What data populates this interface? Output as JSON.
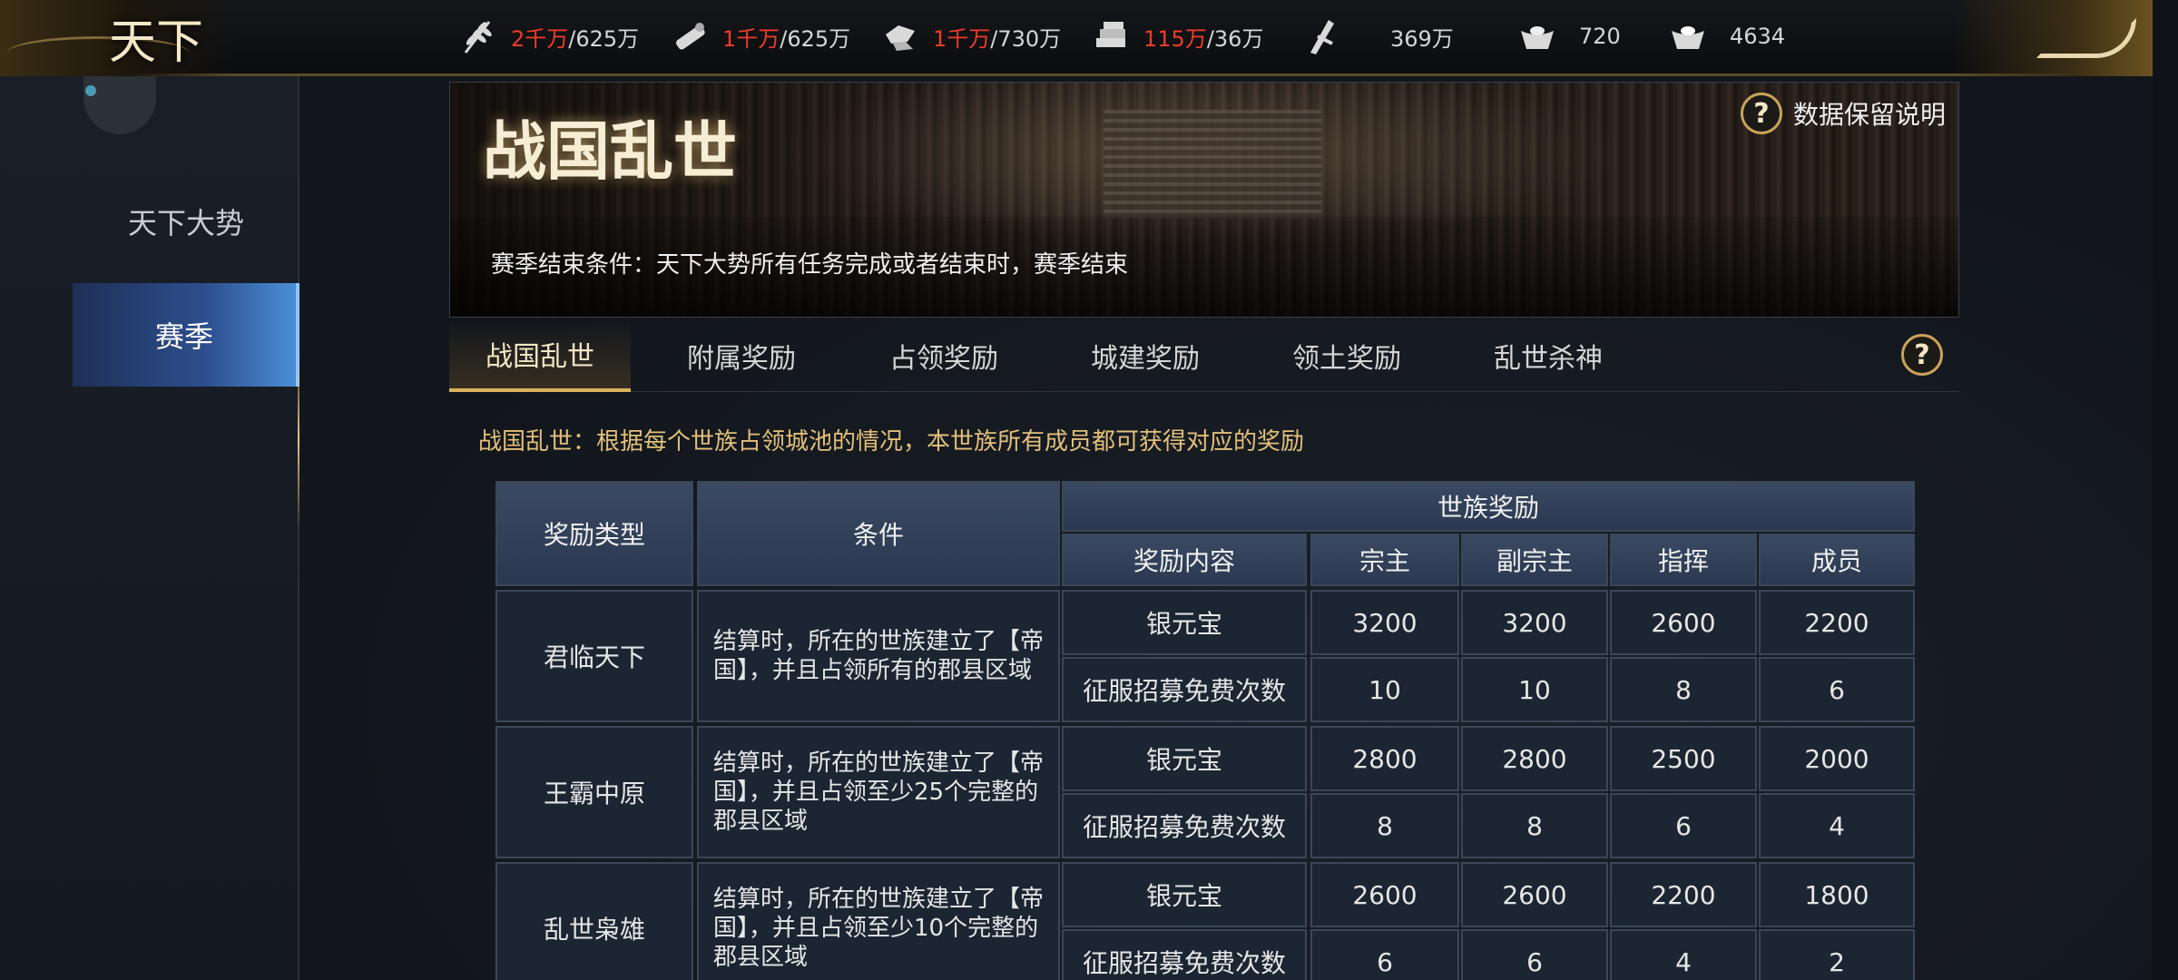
{
  "topbar": {
    "logo": "天下",
    "resources": [
      {
        "icon": "wheat-icon",
        "current": "2千万",
        "cap": "/625万",
        "red": true
      },
      {
        "icon": "wood-icon",
        "current": "1千万",
        "cap": "/625万",
        "red": true
      },
      {
        "icon": "stone-icon",
        "current": "1千万",
        "cap": "/730万",
        "red": true
      },
      {
        "icon": "iron-icon",
        "current": "115万",
        "cap": "/36万",
        "red": true
      },
      {
        "icon": "coin-icon",
        "current": "369万",
        "cap": "",
        "red": false
      },
      {
        "icon": "gold-ingot-icon",
        "current": "720",
        "cap": "",
        "red": false
      },
      {
        "icon": "silver-ingot-icon",
        "current": "4634",
        "cap": "",
        "red": false
      }
    ]
  },
  "sidebar": {
    "items": [
      {
        "label": "天下大势",
        "active": false
      },
      {
        "label": "赛季",
        "active": true
      }
    ]
  },
  "banner": {
    "title": "战国乱世",
    "subtitle": "赛季结束条件：天下大势所有任务完成或者结束时，赛季结束",
    "info_label": "数据保留说明"
  },
  "tabs": [
    {
      "label": "战国乱世",
      "active": true
    },
    {
      "label": "附属奖励",
      "active": false
    },
    {
      "label": "占领奖励",
      "active": false
    },
    {
      "label": "城建奖励",
      "active": false
    },
    {
      "label": "领土奖励",
      "active": false
    },
    {
      "label": "乱世杀神",
      "active": false
    }
  ],
  "description": "战国乱世：根据每个世族占领城池的情况，本世族所有成员都可获得对应的奖励",
  "table": {
    "headers": {
      "type": "奖励类型",
      "condition": "条件",
      "group": "世族奖励",
      "content": "奖励内容",
      "roles": [
        "宗主",
        "副宗主",
        "指挥",
        "成员"
      ]
    },
    "rows": [
      {
        "type": "君临天下",
        "condition": "结算时，所在的世族建立了【帝国】，并且占领所有的郡县区域",
        "rewards": [
          {
            "name": "银元宝",
            "values": [
              "3200",
              "3200",
              "2600",
              "2200"
            ]
          },
          {
            "name": "征服招募免费次数",
            "values": [
              "10",
              "10",
              "8",
              "6"
            ]
          }
        ]
      },
      {
        "type": "王霸中原",
        "condition": "结算时，所在的世族建立了【帝国】，并且占领至少25个完整的郡县区域",
        "rewards": [
          {
            "name": "银元宝",
            "values": [
              "2800",
              "2800",
              "2500",
              "2000"
            ]
          },
          {
            "name": "征服招募免费次数",
            "values": [
              "8",
              "8",
              "6",
              "4"
            ]
          }
        ]
      },
      {
        "type": "乱世枭雄",
        "condition": "结算时，所在的世族建立了【帝国】，并且占领至少10个完整的郡县区域",
        "rewards": [
          {
            "name": "银元宝",
            "values": [
              "2600",
              "2600",
              "2200",
              "1800"
            ]
          },
          {
            "name": "征服招募免费次数",
            "values": [
              "6",
              "6",
              "4",
              "2"
            ]
          }
        ]
      }
    ]
  }
}
